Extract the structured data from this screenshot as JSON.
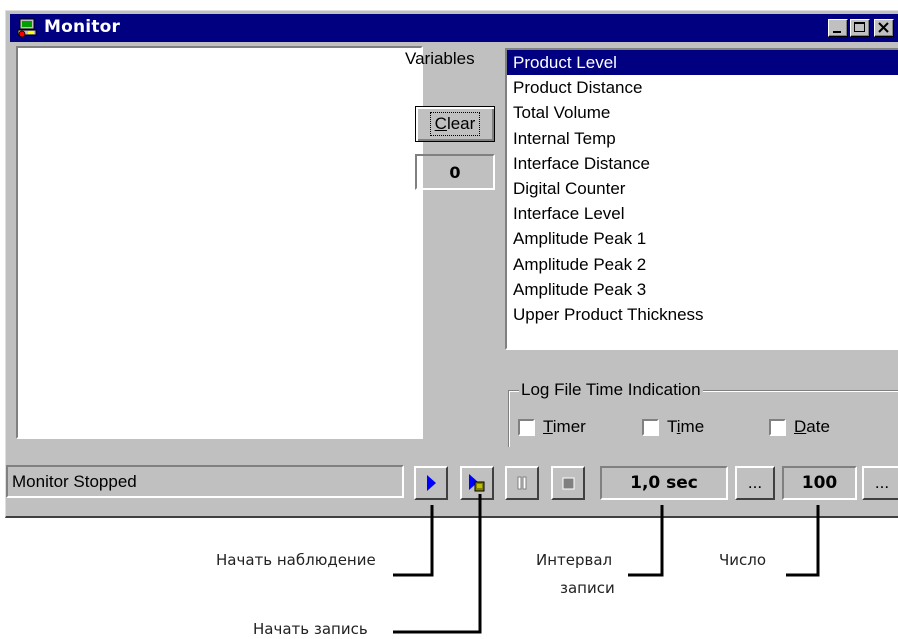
{
  "window": {
    "title": "Monitor",
    "buttons": [
      "minimize",
      "maximize",
      "close"
    ]
  },
  "variables": {
    "label": "Variables",
    "clear_button": "Clear",
    "clear_accel": "C",
    "count": "0",
    "items": [
      "Product Level",
      "Product Distance",
      "Total Volume",
      "Internal Temp",
      "Interface Distance",
      "Digital Counter",
      "Interface Level",
      "Amplitude Peak 1",
      "Amplitude Peak 2",
      "Amplitude Peak 3",
      "Upper Product Thickness"
    ],
    "selected_index": 0
  },
  "log_time": {
    "label": "Log File Time Indication",
    "options": [
      {
        "label": "Timer",
        "accel": "T",
        "checked": false
      },
      {
        "label": "Time",
        "accel": "i",
        "checked": false
      },
      {
        "label": "Date",
        "accel": "D",
        "checked": false
      }
    ]
  },
  "toolbar": {
    "status": "Monitor Stopped",
    "interval": "1,0 sec",
    "interval_more": "...",
    "count": "100",
    "count_more": "..."
  },
  "callouts": {
    "start_monitoring": "Начать наблюдение",
    "start_recording": "Начать запись",
    "interval_line1": "Интервал",
    "interval_line2": "записи",
    "number": "Число"
  },
  "colors": {
    "titlebar": "#000080",
    "face": "#c0c0c0",
    "selection": "#000080",
    "play_arrow": "#0000ff"
  }
}
